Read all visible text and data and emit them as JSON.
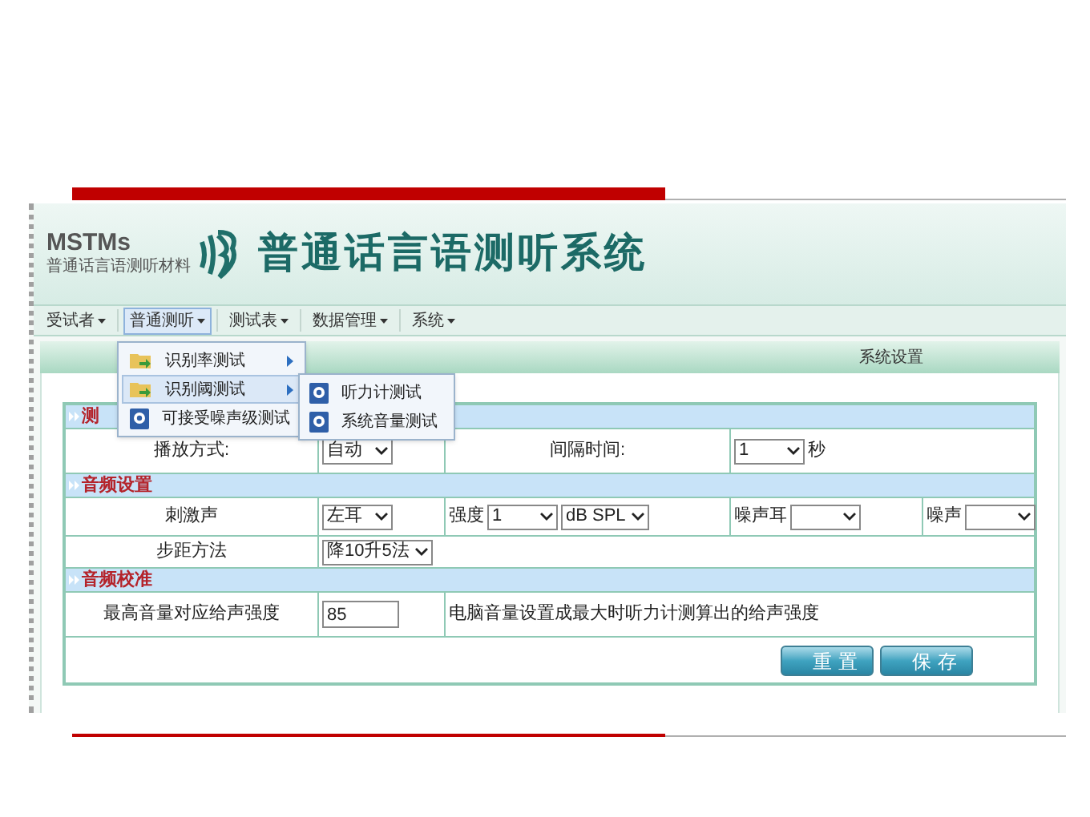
{
  "app": {
    "logo": {
      "abbr": "MSTMs",
      "subtitle": "普通话言语测听材料"
    },
    "title": "普通话言语测听系统"
  },
  "menu_bar": [
    {
      "label": "受试者",
      "selected": false
    },
    {
      "label": "普通测听",
      "selected": true
    },
    {
      "label": "测试表",
      "selected": false
    },
    {
      "label": "数据管理",
      "selected": false
    },
    {
      "label": "系统",
      "selected": false
    }
  ],
  "dropdown": [
    {
      "label": "识别率测试",
      "kind": "folder",
      "has_submenu": true,
      "selected": false
    },
    {
      "label": "识别阈测试",
      "kind": "folder",
      "has_submenu": true,
      "selected": true
    },
    {
      "label": "可接受噪声级测试",
      "kind": "app",
      "has_submenu": false,
      "selected": false
    }
  ],
  "submenu": [
    {
      "label": "听力计测试",
      "kind": "app"
    },
    {
      "label": "系统音量测试",
      "kind": "app"
    }
  ],
  "panel": {
    "title": "系统设置"
  },
  "form": {
    "sections": [
      {
        "title": "测",
        "rows": [
          {
            "cells": [
              {
                "kind": "label",
                "items": [
                  {
                    "kind": "text",
                    "value": "播放方式:"
                  }
                ]
              },
              {
                "kind": "value",
                "items": [
                  {
                    "kind": "select",
                    "value": "自动"
                  }
                ]
              },
              {
                "kind": "label",
                "items": [
                  {
                    "kind": "text",
                    "value": "间隔时间:"
                  }
                ]
              },
              {
                "kind": "value",
                "items": [
                  {
                    "kind": "select",
                    "value": "1"
                  },
                  {
                    "kind": "text",
                    "value": "秒"
                  }
                ]
              }
            ]
          }
        ]
      },
      {
        "title": "音频设置",
        "rows": [
          {
            "cells": [
              {
                "kind": "label",
                "items": [
                  {
                    "kind": "text",
                    "value": "刺激声"
                  }
                ]
              },
              {
                "kind": "value",
                "items": [
                  {
                    "kind": "select",
                    "value": "左耳"
                  }
                ]
              },
              {
                "kind": "value",
                "items": [
                  {
                    "kind": "text",
                    "value": "强度"
                  },
                  {
                    "kind": "select",
                    "value": "1"
                  },
                  {
                    "kind": "select",
                    "value": "dB SPL"
                  }
                ]
              },
              {
                "kind": "value",
                "items": [
                  {
                    "kind": "text",
                    "value": "噪声耳"
                  },
                  {
                    "kind": "select",
                    "value": ""
                  }
                ]
              },
              {
                "kind": "value",
                "items": [
                  {
                    "kind": "text",
                    "value": "噪声"
                  },
                  {
                    "kind": "select",
                    "value": ""
                  }
                ]
              }
            ]
          },
          {
            "cells": [
              {
                "kind": "label",
                "items": [
                  {
                    "kind": "text",
                    "value": "步距方法"
                  }
                ]
              },
              {
                "kind": "value",
                "items": [
                  {
                    "kind": "select",
                    "value": "降10升5法"
                  }
                ]
              }
            ]
          }
        ]
      },
      {
        "title": "音频校准",
        "rows": [
          {
            "cells": [
              {
                "kind": "label",
                "items": [
                  {
                    "kind": "text",
                    "value": "最高音量对应给声强度"
                  }
                ]
              },
              {
                "kind": "value",
                "items": [
                  {
                    "kind": "input",
                    "value": "85"
                  }
                ]
              },
              {
                "kind": "value",
                "items": [
                  {
                    "kind": "text",
                    "value": "电脑音量设置成最大时听力计测算出的给声强度"
                  }
                ]
              }
            ]
          }
        ]
      }
    ],
    "buttons": [
      "重置",
      "保存"
    ]
  }
}
